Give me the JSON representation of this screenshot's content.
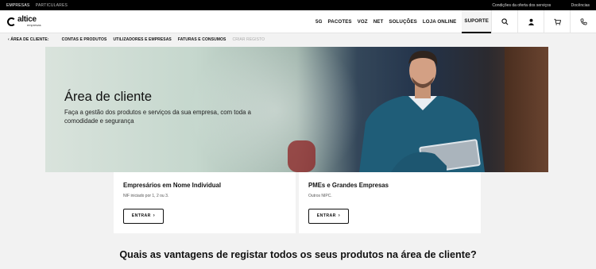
{
  "topbar": {
    "segment_active": "EMPRESAS",
    "segment_other": "PARTICULARES",
    "link_conditions": "Condições da oferta dos serviços",
    "link_docs": "Docências"
  },
  "brand": {
    "name": "altice",
    "sub": "empresas"
  },
  "nav": {
    "items": [
      "5G",
      "PACOTES",
      "VOZ",
      "NET",
      "SOLUÇÕES",
      "LOJA ONLINE"
    ],
    "active": "SUPORTE",
    "icons": [
      "search-icon",
      "user-icon",
      "cart-icon",
      "phone-icon"
    ]
  },
  "subnav": {
    "back": "ÁREA DE CLIENTE:",
    "items": [
      "CONTAS E PRODUTOS",
      "UTILIZADORES E EMPRESAS",
      "FATURAS E CONSUMOS"
    ],
    "muted": "CRIAR REGISTO"
  },
  "hero": {
    "title": "Área de cliente",
    "description": "Faça a gestão dos produtos e serviços da sua empresa, com toda a comodidade e segurança"
  },
  "cards": [
    {
      "title": "Empresários em Nome Individual",
      "subtitle": "NIF iniciado por 1, 2 ou 3.",
      "button": "ENTRAR"
    },
    {
      "title": "PMEs e Grandes Empresas",
      "subtitle": "Outros NIPC.",
      "button": "ENTRAR"
    }
  ],
  "question": "Quais as vantagens de registar todos os seus produtos na área de cliente?",
  "colors": {
    "accent": "#000000",
    "background": "#f2f2f2"
  }
}
